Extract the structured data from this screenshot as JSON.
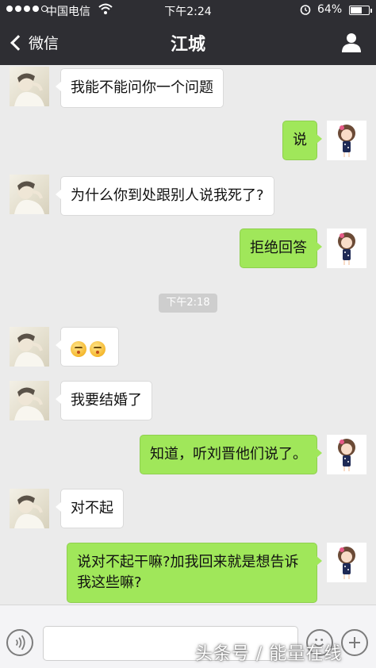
{
  "status_bar": {
    "carrier": "中国电信",
    "time": "下午2:24",
    "battery_percent_label": "64%",
    "battery_level": 0.64,
    "icons": [
      "signal-dots",
      "wifi-icon",
      "alarm-icon",
      "battery-icon"
    ]
  },
  "nav": {
    "back_label": "微信",
    "title": "江城",
    "icons": [
      "chevron-left-icon",
      "profile-icon"
    ]
  },
  "messages": [
    {
      "side": "left",
      "text": "我能不能问你一个问题"
    },
    {
      "side": "right",
      "text": "说"
    },
    {
      "side": "left",
      "text": "为什么你到处跟别人说我死了?"
    },
    {
      "side": "right",
      "text": "拒绝回答"
    },
    {
      "side": "left",
      "emoji": [
        "kiss-face-emoji",
        "kiss-face-emoji"
      ]
    },
    {
      "side": "left",
      "text": "我要结婚了"
    },
    {
      "side": "right",
      "text": "知道，听刘晋他们说了。"
    },
    {
      "side": "left",
      "text": "对不起"
    },
    {
      "side": "right",
      "text": "说对不起干嘛?加我回来就是想告诉我这些嘛?"
    }
  ],
  "timestamp": "下午2:18",
  "input_bar": {
    "icons": [
      "voice-icon",
      "emoji-icon",
      "plus-icon"
    ]
  },
  "watermark": "头条号 / 能量在线",
  "colors": {
    "nav_background": "#2e2e33",
    "chat_background": "#ebebeb",
    "outgoing_bubble": "#a0e75a",
    "incoming_bubble": "#ffffff"
  }
}
